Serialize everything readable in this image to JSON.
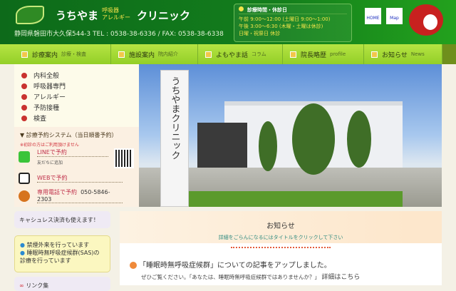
{
  "header": {
    "site_name": "うちやま",
    "sub1": "呼吸器",
    "sub2": "アレルギー",
    "site_name2": "クリニック",
    "address": "静岡県磐田市大久保544-3 TEL : 0538-38-6336 / FAX: 0538-38-6338",
    "hours_title": "診療時間・休診日",
    "hours": [
      "午前 9:00〜12:00 (土曜日 9:00〜1:00)",
      "午後 3:00〜6:30 (木曜・土曜は休診)",
      "日曜・祝祭日 休診"
    ],
    "home": "HOME",
    "map": "Map"
  },
  "nav": [
    {
      "label": "診療案内",
      "sub": "診療・検査"
    },
    {
      "label": "施設案内",
      "sub": "院内紹介"
    },
    {
      "label": "よもやま話",
      "sub": "コラム"
    },
    {
      "label": "院長略歴",
      "sub": "profile"
    },
    {
      "label": "お知らせ",
      "sub": "News"
    }
  ],
  "menu": [
    "内科全般",
    "呼吸器専門",
    "アレルギー",
    "予防接種",
    "検査"
  ],
  "reserve": {
    "title": "▼ 診療予約システム（当日順番予約）",
    "note": "※初診の方はご利用頂けません",
    "line": "LINEで予約",
    "line_sub": "友だちに追加",
    "web": "WEBで予約",
    "phone": "専用電話で予約",
    "phone_num": "050-5846-2303"
  },
  "photo": {
    "sign": "うちやまクリニック"
  },
  "side": {
    "cashless": "キャシュレス決済も使えます！",
    "items": [
      "禁煙外来を行っています",
      "睡眠時無呼吸症候群(SAS)の診療を行っています"
    ],
    "links": "リンク集"
  },
  "main": {
    "title": "お知らせ",
    "subtitle": "詳細をごらんになるにはタイトルをクリックして下さい",
    "news_title": "「睡眠時無呼吸症候群」についての記事をアップしました。",
    "news_body": "ぜひご覧ください。「あなたは、睡眠時無呼吸症候群ではありませんか？」",
    "news_link": "詳細はこちら"
  }
}
